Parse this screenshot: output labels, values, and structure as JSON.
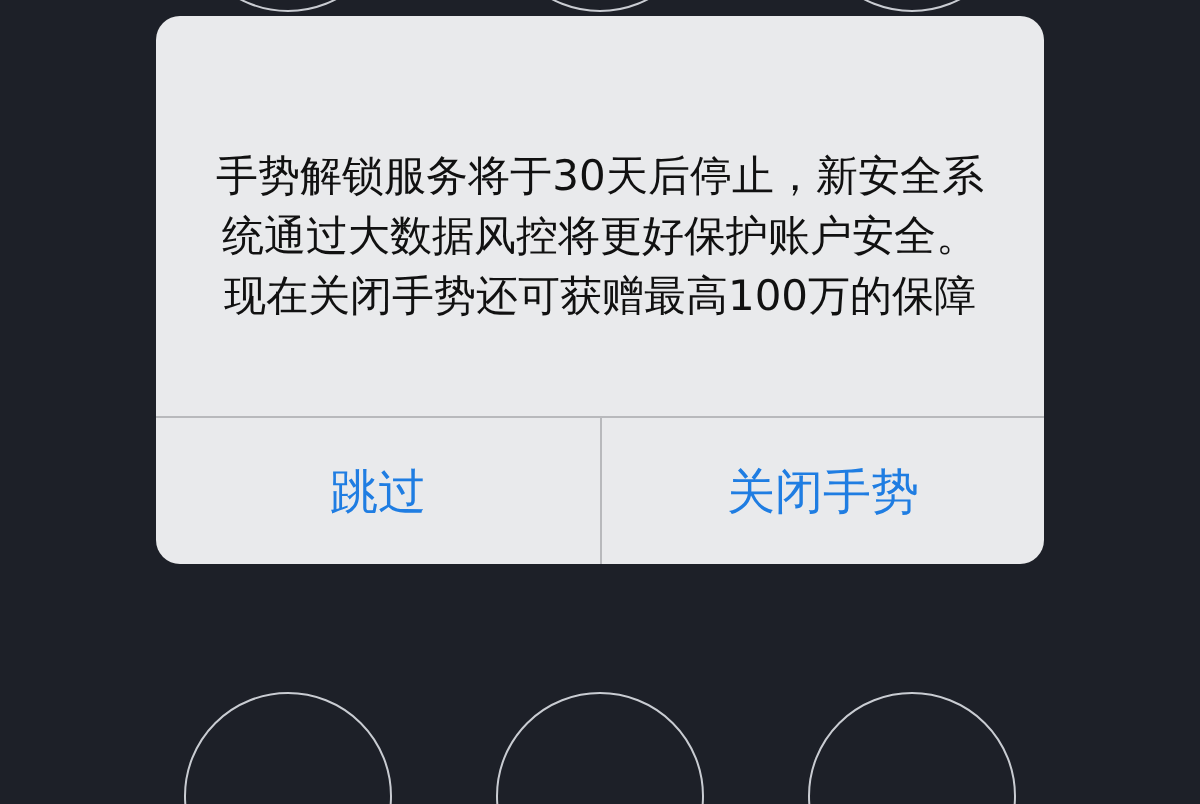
{
  "dialog": {
    "message": "手势解锁服务将于30天后停止，新安全系统通过大数据风控将更好保护账户安全。现在关闭手势还可获赠最高100万的保障",
    "buttons": [
      {
        "label": "跳过"
      },
      {
        "label": "关闭手势"
      }
    ]
  }
}
